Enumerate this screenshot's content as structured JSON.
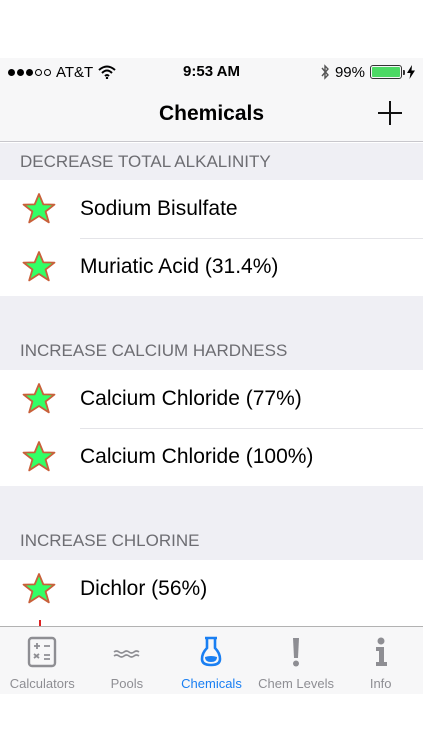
{
  "status_bar": {
    "carrier": "AT&T",
    "time": "9:53 AM",
    "battery_percent": "99%",
    "battery_level": 0.99,
    "signal_bars_filled": 3,
    "signal_bars_total": 5
  },
  "nav": {
    "title": "Chemicals",
    "add_icon": "plus-icon"
  },
  "sections": [
    {
      "header": "DECREASE TOTAL ALKALINITY",
      "items": [
        {
          "label": "Sodium Bisulfate"
        },
        {
          "label": "Muriatic Acid (31.4%)"
        }
      ]
    },
    {
      "header": "INCREASE CALCIUM HARDNESS",
      "items": [
        {
          "label": "Calcium Chloride (77%)"
        },
        {
          "label": "Calcium Chloride (100%)"
        }
      ]
    },
    {
      "header": "INCREASE CHLORINE",
      "items": [
        {
          "label": "Dichlor (56%)"
        }
      ]
    }
  ],
  "tabs": [
    {
      "label": "Calculators",
      "icon": "calculator-icon",
      "active": false
    },
    {
      "label": "Pools",
      "icon": "water-waves-icon",
      "active": false
    },
    {
      "label": "Chemicals",
      "icon": "flask-icon",
      "active": true
    },
    {
      "label": "Chem Levels",
      "icon": "exclamation-icon",
      "active": false
    },
    {
      "label": "Info",
      "icon": "info-icon",
      "active": false
    }
  ],
  "colors": {
    "accent": "#1a7ff2",
    "star_fill": "#33ff66",
    "star_stroke": "#c9603a",
    "battery_green": "#4cd964",
    "section_bg": "#efeff4",
    "inactive_tab": "#8e8e93"
  }
}
